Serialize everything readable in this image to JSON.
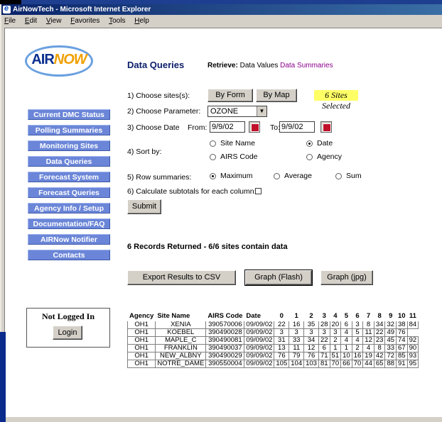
{
  "window": {
    "title": "AirNowTech - Microsoft Internet Explorer"
  },
  "menu": [
    "File",
    "Edit",
    "View",
    "Favorites",
    "Tools",
    "Help"
  ],
  "logo": {
    "air": "AIR",
    "now": "NOW"
  },
  "nav": [
    "Current DMC Status",
    "Polling Summaries",
    "Monitoring Sites",
    "Data Queries",
    "Forecast System",
    "Forecast Queries",
    "Agency Info / Setup",
    "Documentation/FAQ",
    "AIRNow Notifier",
    "Contacts"
  ],
  "login": {
    "status": "Not Logged In",
    "button": "Login"
  },
  "page": {
    "title": "Data Queries",
    "retrieve_label": "Retrieve:",
    "retrieve_values": "Data Values",
    "retrieve_summaries": "Data Summaries"
  },
  "form": {
    "step1": "1) Choose sites(s):",
    "by_form": "By Form",
    "by_map": "By Map",
    "sites_selected": "6 Sites Selected",
    "step2": "2) Choose Parameter:",
    "parameter": "OZONE",
    "step3": "3) Choose Date",
    "from_label": "From:",
    "from_value": "9/9/02",
    "to_label": "To:",
    "to_value": "9/9/02",
    "step4": "4) Sort by:",
    "sort_site_name": "Site Name",
    "sort_date": "Date",
    "sort_airs": "AIRS Code",
    "sort_agency": "Agency",
    "step5": "5) Row summaries:",
    "sum_maximum": "Maximum",
    "sum_average": "Average",
    "sum_sum": "Sum",
    "step6": "6) Calculate subtotals for each column:",
    "submit": "Submit"
  },
  "results": {
    "summary": "6 Records Returned - 6/6 sites contain data",
    "export_csv": "Export Results to CSV",
    "graph_flash": "Graph (Flash)",
    "graph_jpg": "Graph (jpg)"
  },
  "table": {
    "headers": [
      "Agency",
      "Site Name",
      "AIRS Code",
      "Date",
      "0",
      "1",
      "2",
      "3",
      "4",
      "5",
      "6",
      "7",
      "8",
      "9",
      "10",
      "11"
    ],
    "rows": [
      [
        "OH1",
        "XENIA",
        "390570006",
        "09/09/02",
        "22",
        "16",
        "35",
        "28",
        "20",
        "6",
        "3",
        "8",
        "34",
        "32",
        "38",
        "84"
      ],
      [
        "OH1",
        "KOEBEL",
        "390490028",
        "09/09/02",
        "3",
        "3",
        "3",
        "3",
        "3",
        "4",
        "5",
        "11",
        "22",
        "49",
        "76"
      ],
      [
        "OH1",
        "MAPLE_C",
        "390490081",
        "09/09/02",
        "31",
        "33",
        "34",
        "22",
        "2",
        "4",
        "4",
        "12",
        "23",
        "45",
        "74",
        "92"
      ],
      [
        "OH1",
        "FRANKLIN",
        "390490037",
        "09/09/02",
        "13",
        "11",
        "12",
        "6",
        "1",
        "1",
        "2",
        "4",
        "8",
        "33",
        "67",
        "90"
      ],
      [
        "OH1",
        "NEW_ALBNY",
        "390490029",
        "09/09/02",
        "76",
        "79",
        "76",
        "71",
        "51",
        "10",
        "16",
        "19",
        "42",
        "72",
        "85",
        "93"
      ],
      [
        "OH1",
        "NOTRE_DAME",
        "390550004",
        "09/09/02",
        "105",
        "104",
        "103",
        "81",
        "70",
        "66",
        "70",
        "44",
        "65",
        "88",
        "91",
        "95"
      ]
    ]
  }
}
